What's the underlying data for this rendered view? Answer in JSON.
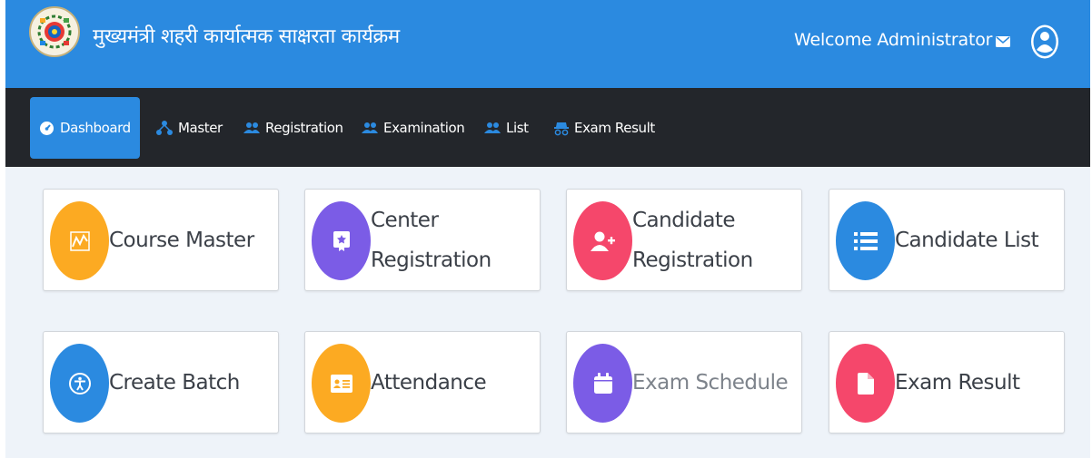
{
  "header": {
    "title": "मुख्यमंत्री शहरी कार्यात्मक साक्षरता कार्यक्रम",
    "welcome": "Welcome Administrator",
    "logo_icon": "program-emblem-logo",
    "mail_icon": "envelope-icon",
    "user_icon": "user-avatar-icon"
  },
  "nav": {
    "items": [
      {
        "label": "Dashboard",
        "icon": "dashboard-gauge-icon",
        "active": true
      },
      {
        "label": "Master",
        "icon": "sitemap-icon"
      },
      {
        "label": "Registration",
        "icon": "users-icon"
      },
      {
        "label": "Examination",
        "icon": "users-icon"
      },
      {
        "label": "List",
        "icon": "users-icon"
      },
      {
        "label": "Exam Result",
        "icon": "incognito-icon"
      }
    ]
  },
  "cards": [
    {
      "label": "Course Master",
      "icon": "chart-line-icon",
      "color": "#fcaa22"
    },
    {
      "label": "Center\nRegistration",
      "icon": "certificate-icon",
      "color": "#7b5ce6"
    },
    {
      "label": "Candidate\nRegistration",
      "icon": "user-plus-icon",
      "color": "#f5476b"
    },
    {
      "label": "Candidate List",
      "icon": "list-icon",
      "color": "#2b8ae0"
    },
    {
      "label": "Create Batch",
      "icon": "accessibility-icon",
      "color": "#2b8ae0"
    },
    {
      "label": "Attendance",
      "icon": "id-card-icon",
      "color": "#fcaa22"
    },
    {
      "label": "Exam Schedule",
      "icon": "calendar-icon",
      "color": "#7b5ce6"
    },
    {
      "label": "Exam Result",
      "icon": "file-icon",
      "color": "#f5476b"
    }
  ],
  "colors": {
    "header_blue": "#2b8ae0",
    "nav_dark": "#23262b",
    "background": "#eef3f9"
  }
}
